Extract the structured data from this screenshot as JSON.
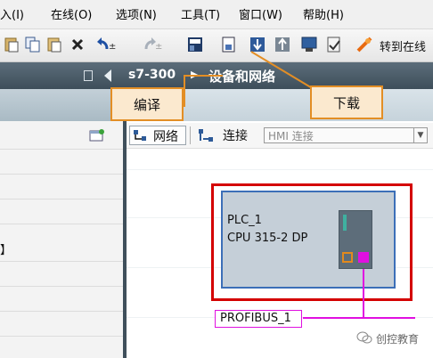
{
  "menu": {
    "items": [
      {
        "label": "入(I)"
      },
      {
        "label": "在线(O)"
      },
      {
        "label": "选项(N)"
      },
      {
        "label": "工具(T)"
      },
      {
        "label": "窗口(W)"
      },
      {
        "label": "帮助(H)"
      }
    ]
  },
  "toolbar": {
    "go_online_label": "转到在线"
  },
  "titlebar": {
    "breadcrumb_project": "s7-300",
    "breadcrumb_separator": "▶",
    "breadcrumb_page": "设备和网络"
  },
  "callouts": {
    "compile": "编译",
    "download": "下载"
  },
  "network_toolbar": {
    "network_label": "网络",
    "connection_label": "连接",
    "connection_type": "HMI 连接"
  },
  "left_panel": {
    "bracket_text": "】"
  },
  "plc": {
    "name": "PLC_1",
    "cpu": "CPU 315-2 DP"
  },
  "network": {
    "bus_name": "PROFIBUS_1"
  },
  "watermark": {
    "text": "创控教育"
  },
  "colors": {
    "highlight_red": "#d40000",
    "callout_border": "#e38e25",
    "profibus_magenta": "#e010e0",
    "titlebar": "#4b5c69"
  }
}
